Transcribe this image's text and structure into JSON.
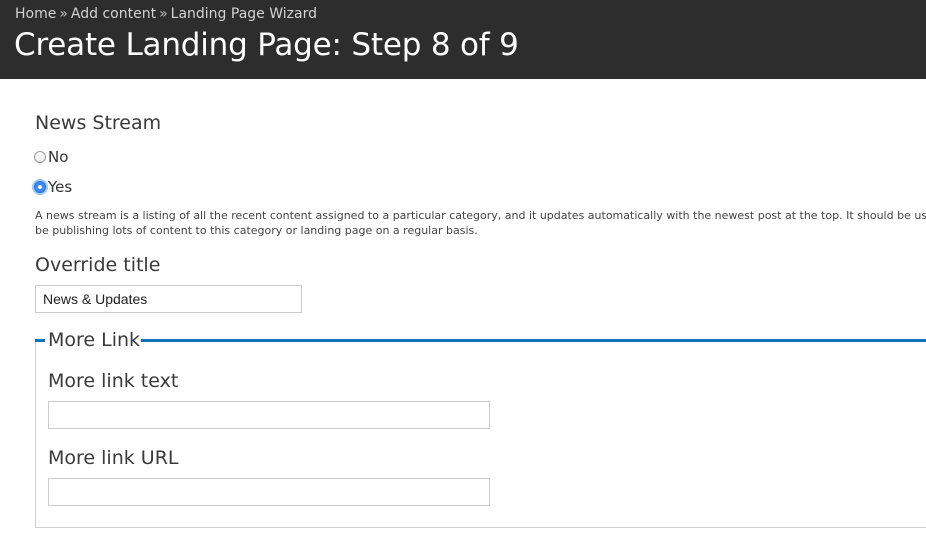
{
  "breadcrumb": {
    "items": [
      "Home",
      "Add content",
      "Landing Page Wizard"
    ],
    "separator": "»"
  },
  "page_title": "Create Landing Page: Step 8 of 9",
  "news_stream": {
    "label": "News Stream",
    "options": [
      {
        "label": "No",
        "selected": false
      },
      {
        "label": "Yes",
        "selected": true
      }
    ],
    "description_line1": "A news stream is a listing of all the recent content assigned to a particular category, and it updates automatically with the newest post at the top. It should be us",
    "description_line2": "be publishing lots of content to this category or landing page on a regular basis."
  },
  "override_title": {
    "label": "Override title",
    "value": "News & Updates"
  },
  "more_link": {
    "legend": "More Link",
    "text_label": "More link text",
    "text_value": "",
    "url_label": "More link URL",
    "url_value": ""
  },
  "colors": {
    "header_bg": "#2d2d2d",
    "accent": "#0a74b9",
    "radio_selected": "#3b8bf0"
  }
}
